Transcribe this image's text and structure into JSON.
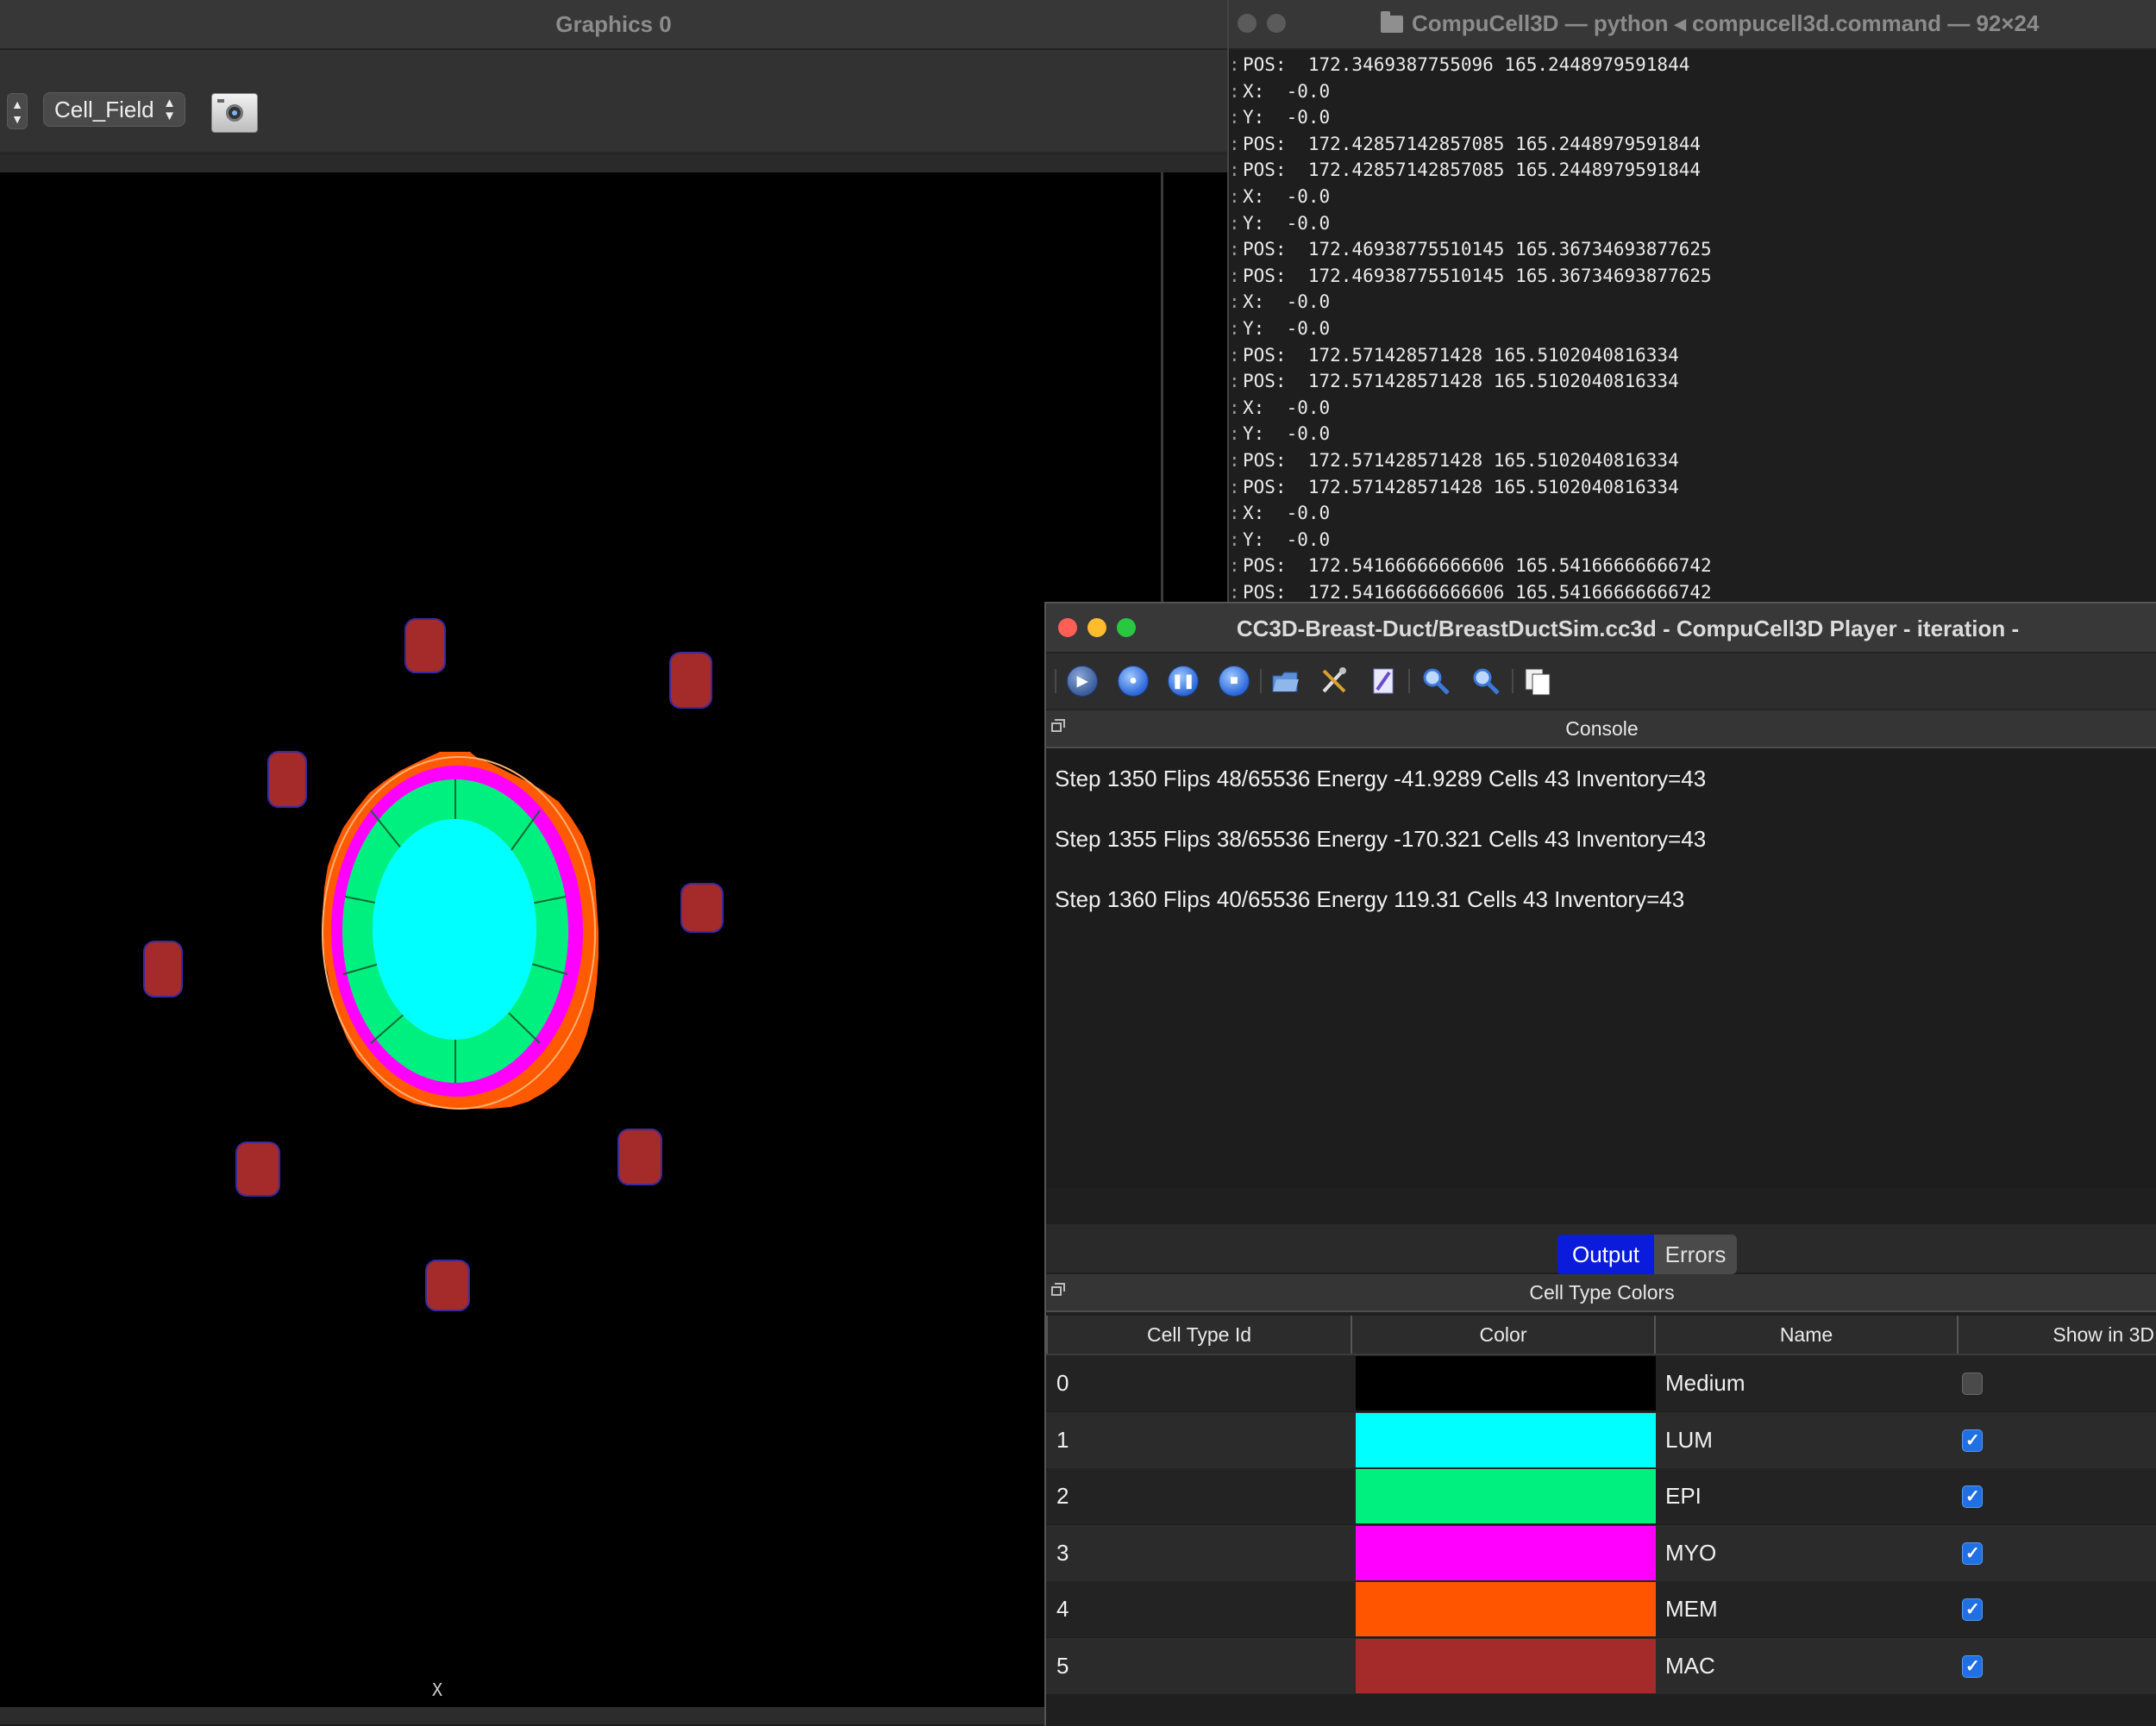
{
  "graphics_window": {
    "title": "Graphics 0",
    "field_select": "Cell_Field",
    "stepper_up": "▲",
    "stepper_down": "▼",
    "axis_label": "X",
    "icons": {
      "camera": "camera-icon"
    }
  },
  "terminal": {
    "title": "CompuCell3D — python ◂ compucell3d.command — 92×24",
    "gutter": ":",
    "lines": [
      "POS:  172.3469387755096 165.2448979591844",
      "X:  -0.0",
      "Y:  -0.0",
      "POS:  172.42857142857085 165.2448979591844",
      "POS:  172.42857142857085 165.2448979591844",
      "X:  -0.0",
      "Y:  -0.0",
      "POS:  172.46938775510145 165.36734693877625",
      "POS:  172.46938775510145 165.36734693877625",
      "X:  -0.0",
      "Y:  -0.0",
      "POS:  172.571428571428 165.5102040816334",
      "POS:  172.571428571428 165.5102040816334",
      "X:  -0.0",
      "Y:  -0.0",
      "POS:  172.571428571428 165.5102040816334",
      "POS:  172.571428571428 165.5102040816334",
      "X:  -0.0",
      "Y:  -0.0",
      "POS:  172.54166666666606 165.54166666666742",
      "POS:  172.54166666666606 165.54166666666742"
    ]
  },
  "player": {
    "title": "CC3D-Breast-Duct/BreastDuctSim.cc3d - CompuCell3D Player - iteration -",
    "toolbar_icons": [
      "play-icon",
      "step-icon",
      "pause-icon",
      "stop-icon",
      "open-folder-icon",
      "tools-icon",
      "edit-icon",
      "zoom-in-icon",
      "zoom-out-icon",
      "copy-window-icon"
    ],
    "console": {
      "header": "Console",
      "lines": [
        "Step 1350 Flips 48/65536 Energy -41.9289 Cells 43 Inventory=43",
        "Step 1355 Flips 38/65536 Energy -170.321 Cells 43 Inventory=43",
        "Step 1360 Flips 40/65536 Energy 119.31 Cells 43 Inventory=43"
      ],
      "tabs": {
        "output": "Output",
        "errors": "Errors"
      }
    },
    "cell_type_colors": {
      "header": "Cell Type Colors",
      "columns": [
        "Cell Type Id",
        "Color",
        "Name",
        "Show in 3D"
      ],
      "rows": [
        {
          "id": "0",
          "color": "#000000",
          "name": "Medium",
          "show": false
        },
        {
          "id": "1",
          "color": "#00ffff",
          "name": "LUM",
          "show": true
        },
        {
          "id": "2",
          "color": "#00f080",
          "name": "EPI",
          "show": true
        },
        {
          "id": "3",
          "color": "#ff00ff",
          "name": "MYO",
          "show": true
        },
        {
          "id": "4",
          "color": "#ff5500",
          "name": "MEM",
          "show": true
        },
        {
          "id": "5",
          "color": "#a52a2a",
          "name": "MAC",
          "show": true
        }
      ]
    }
  }
}
